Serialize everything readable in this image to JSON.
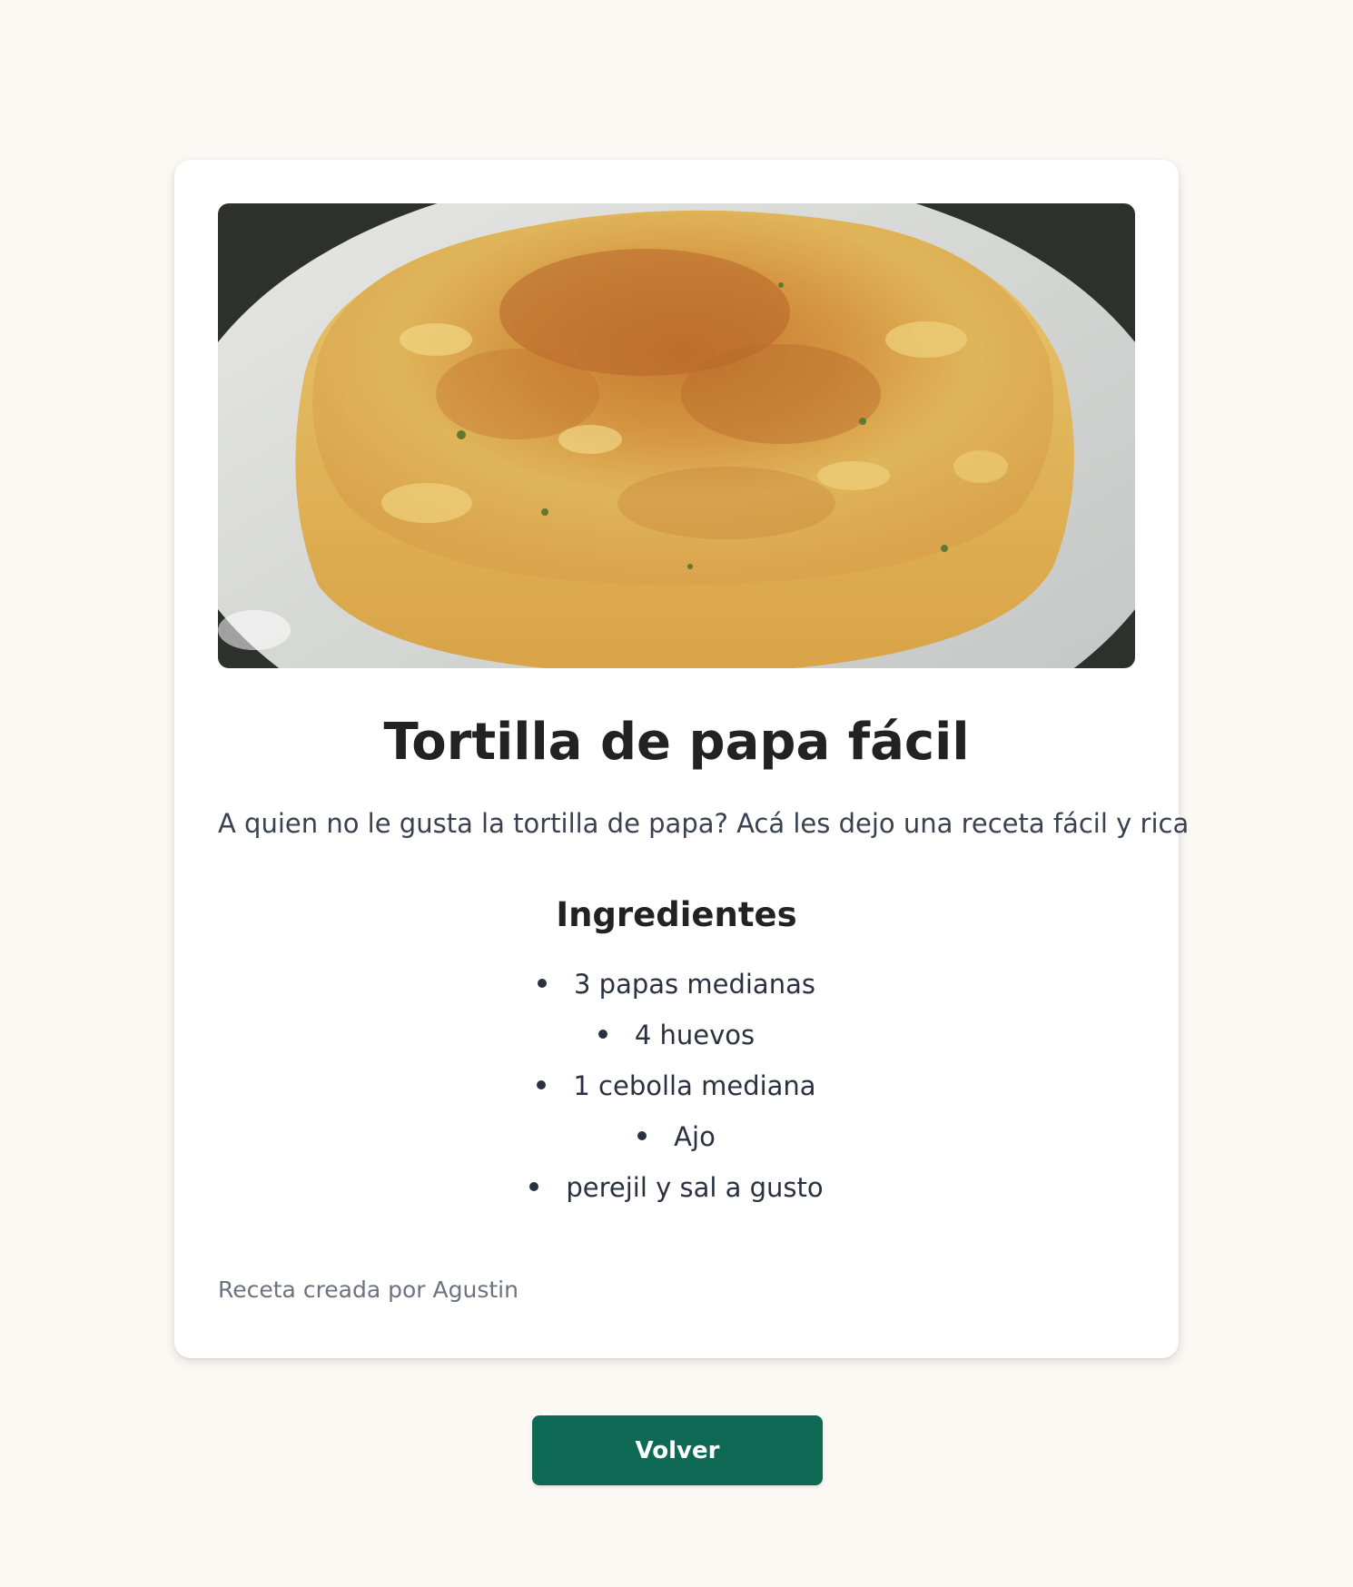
{
  "recipe": {
    "image_alt": "tortilla-de-papa-photo",
    "title": "Tortilla de papa fácil",
    "description": "A quien no le gusta la tortilla de papa? Acá les dejo una receta fácil y rica",
    "ingredients_title": "Ingredientes",
    "ingredients": [
      "3 papas medianas",
      "4 huevos",
      "1 cebolla mediana",
      "Ajo",
      "perejil y sal a gusto"
    ],
    "author_text": "Receta creada por Agustin"
  },
  "actions": {
    "back_label": "Volver"
  },
  "colors": {
    "page_background": "#fcf9f5",
    "card_background": "#ffffff",
    "button_background": "#0f6a55",
    "title_text": "#222222",
    "muted_text": "#6b7280"
  }
}
